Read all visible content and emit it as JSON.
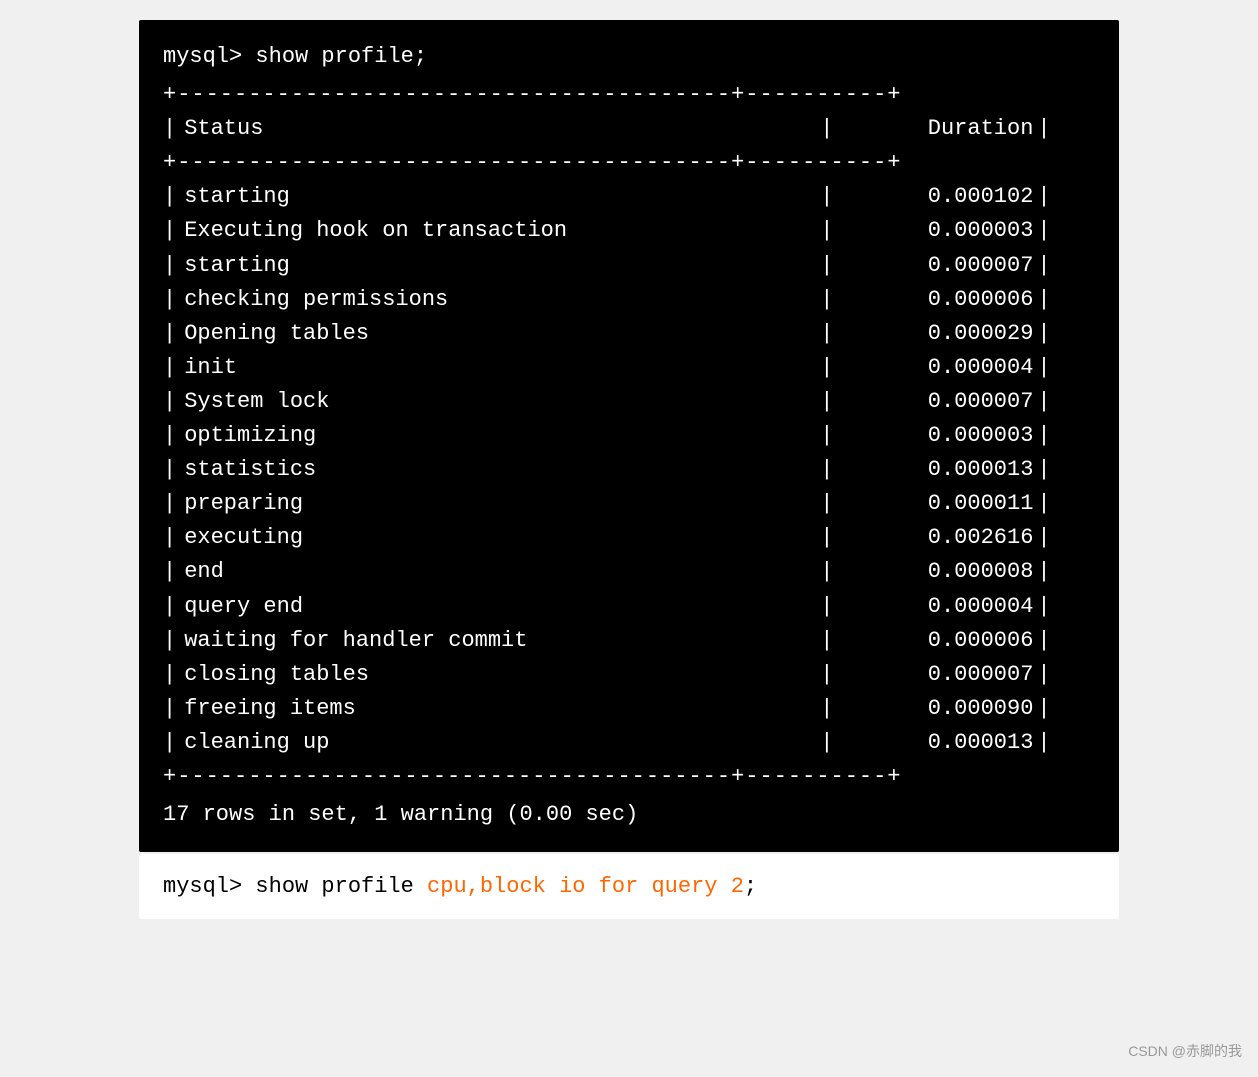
{
  "terminal": {
    "command": "mysql> show profile;",
    "separator_long": "+---------------------------------------+----------+",
    "separator_short": "+---------------------------------------+----------+",
    "header": {
      "status": "Status",
      "duration": "Duration"
    },
    "rows": [
      {
        "status": "starting",
        "duration": "0.000102"
      },
      {
        "status": "Executing hook on transaction",
        "duration": "0.000003"
      },
      {
        "status": "starting",
        "duration": "0.000007"
      },
      {
        "status": "checking permissions",
        "duration": "0.000006"
      },
      {
        "status": "Opening tables",
        "duration": "0.000029"
      },
      {
        "status": "init",
        "duration": "0.000004"
      },
      {
        "status": "System lock",
        "duration": "0.000007"
      },
      {
        "status": "optimizing",
        "duration": "0.000003"
      },
      {
        "status": "statistics",
        "duration": "0.000013"
      },
      {
        "status": "preparing",
        "duration": "0.000011"
      },
      {
        "status": "executing",
        "duration": "0.002616"
      },
      {
        "status": "end",
        "duration": "0.000008"
      },
      {
        "status": "query end",
        "duration": "0.000004"
      },
      {
        "status": "waiting for handler commit",
        "duration": "0.000006"
      },
      {
        "status": "closing tables",
        "duration": "0.000007"
      },
      {
        "status": "freeing items",
        "duration": "0.000090"
      },
      {
        "status": "cleaning up",
        "duration": "0.000013"
      }
    ],
    "summary": "17 rows in set, 1 warning (0.00 sec)"
  },
  "second_block": {
    "command_prefix": "mysql> show profile ",
    "command_highlight": "cpu,block io for query 2",
    "command_suffix": ";"
  },
  "csdn": {
    "label": "CSDN @赤脚的我"
  }
}
